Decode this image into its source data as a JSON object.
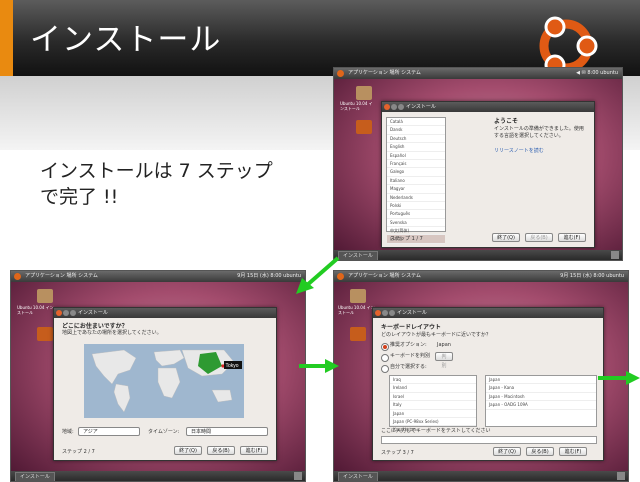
{
  "slide": {
    "title": "インストール",
    "subtitle_line1": "インストールは 7 ステップ",
    "subtitle_line2": "で完了 !!"
  },
  "colors": {
    "accent": "#e98a10",
    "brand_orange": "#dd4814",
    "arrow": "#22cc22"
  },
  "screens": {
    "welcome": {
      "panel_left": "アプリケーション 場所 システム",
      "panel_right": "◀ ✉ 8:00 ubuntu",
      "window_title": "インストール",
      "heading": "ようこそ",
      "desc": "インストールの準備ができました。使用する言語を選択してください。",
      "desc2": "リリースノートを読む",
      "languages": [
        "Català",
        "Dansk",
        "Deutsch",
        "English",
        "Español",
        "Français",
        "Galego",
        "Italiano",
        "Magyar",
        "Nederlands",
        "Polski",
        "Português",
        "Svenska",
        "中文(简体)",
        "日本語"
      ],
      "step": "ステップ 1 / 7",
      "btn_quit": "終了(Q)",
      "btn_back": "戻る(B)",
      "btn_forward": "進む(F)",
      "desktop_icon_label": "Ubuntu 10.04 インストール"
    },
    "location": {
      "panel_left": "アプリケーション 場所 システム",
      "panel_right": "9月 15日 (水) 8:00 ubuntu",
      "window_title": "インストール",
      "heading": "どこにお住まいですか？",
      "desc": "地図上であなたの場所を選択してください。",
      "city_label": "Tokyo",
      "region_label": "地域:",
      "region_value": "アジア",
      "tz_label": "タイムゾーン:",
      "tz_value": "日本時間",
      "step": "ステップ 2 / 7",
      "btn_quit": "終了(Q)",
      "btn_back": "戻る(B)",
      "btn_forward": "進む(F)",
      "desktop_icon_label": "Ubuntu 10.04 インストール",
      "taskbar_task": "インストール"
    },
    "keyboard": {
      "panel_left": "アプリケーション 場所 システム",
      "panel_right": "9月 15日 (水) 8:00 ubuntu",
      "window_title": "インストール",
      "heading": "キーボードレイアウト",
      "desc": "どのレイアウトが最もキーボードに近いですか？",
      "opt_suggested": "推奨オプション:",
      "opt_suggested_value": "Japan",
      "opt_guess": "キーボードを判別",
      "opt_guess_btn": "判別",
      "opt_choose": "自分で選択する:",
      "list_left": [
        "Iraq",
        "Ireland",
        "Israel",
        "Italy",
        "Japan",
        "Japan (PC-98xx Series)",
        "Kazakhstan"
      ],
      "list_right": [
        "Japan",
        "Japan - Kana",
        "Japan - Macintosh",
        "Japan - OADG 109A"
      ],
      "test_hint": "ここに入力してキーボードをテストしてください",
      "step": "ステップ 3 / 7",
      "btn_quit": "終了(Q)",
      "btn_back": "戻る(B)",
      "btn_forward": "進む(F)",
      "desktop_icon_label": "Ubuntu 10.04 インストール",
      "taskbar_task": "インストール"
    }
  }
}
